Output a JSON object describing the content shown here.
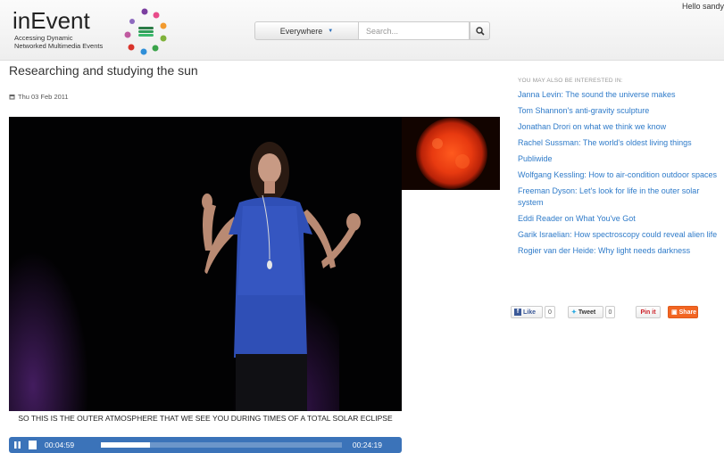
{
  "header": {
    "logo_title": "inEvent",
    "logo_subtitle_line1": "Accessing Dynamic",
    "logo_subtitle_line2": "Networked Multimedia Events",
    "greeting": "Hello sandy",
    "scope_label": "Everywhere",
    "search_placeholder": "Search..."
  },
  "page": {
    "title": "Researching and studying the sun",
    "date": "Thu 03 Feb 2011"
  },
  "player": {
    "caption": "SO THIS IS THE OUTER ATMOSPHERE THAT WE SEE YOU DURING TIMES OF A TOTAL SOLAR ECLIPSE",
    "current_time": "00:04:59",
    "total_time": "00:24:19",
    "progress_fraction": 0.205
  },
  "sidebar": {
    "heading": "YOU MAY ALSO BE INTERESTED IN:",
    "related": [
      "Janna Levin: The sound the universe makes",
      "Tom Shannon's anti-gravity sculpture",
      "Jonathan Drori on what we think we know",
      "Rachel Sussman: The world's oldest living things",
      "Publiwide",
      "Wolfgang Kessling: How to air-condition outdoor spaces",
      "Freeman Dyson: Let's look for life in the outer solar system",
      "Eddi Reader on What You've Got",
      "Garik Israelian: How spectroscopy could reveal alien life",
      "Rogier van der Heide: Why light needs darkness"
    ]
  },
  "share": {
    "like_label": "Like",
    "like_count": "0",
    "tweet_label": "Tweet",
    "tweet_count": "0",
    "pin_label": "Pin it",
    "share_label": "Share"
  },
  "colors": {
    "link": "#2f7bc9",
    "player_bar": "#3b73b9",
    "share_orange": "#f26522",
    "facebook": "#3b5998"
  }
}
